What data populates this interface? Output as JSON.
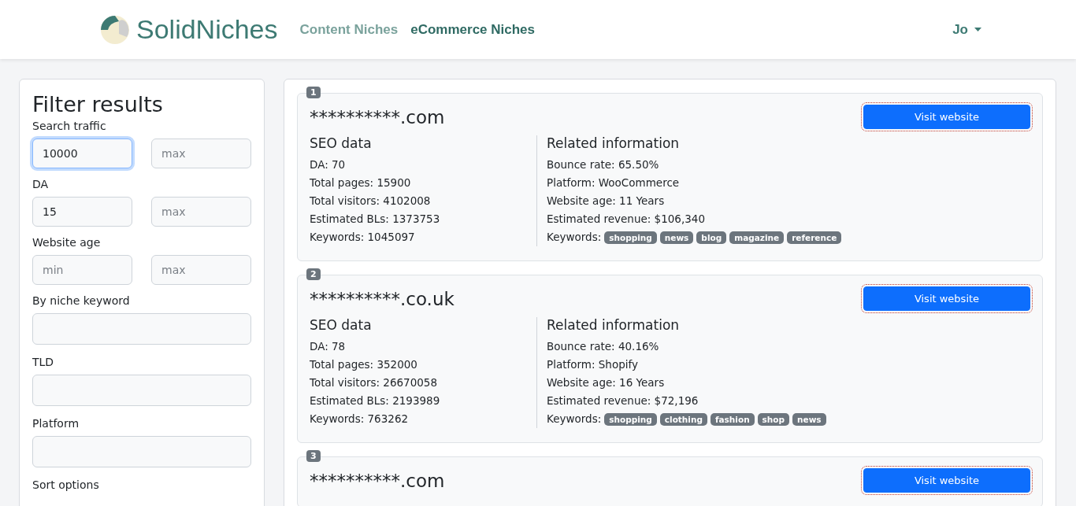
{
  "nav": {
    "logo": "SolidNiches",
    "links": [
      {
        "label": "Content Niches",
        "selected": false
      },
      {
        "label": "eCommerce Niches",
        "selected": true
      }
    ],
    "user": "Jo"
  },
  "filter": {
    "title": "Filter results",
    "groups": [
      {
        "label": "Search traffic",
        "kind": "range",
        "fields": [
          {
            "value": "10000",
            "focused": true
          },
          {
            "placeholder": "max",
            "focused": false
          }
        ]
      },
      {
        "label": "DA",
        "kind": "range",
        "fields": [
          {
            "value": "15",
            "focused": false
          },
          {
            "placeholder": "max",
            "focused": false
          }
        ]
      },
      {
        "label": "Website age",
        "kind": "range",
        "fields": [
          {
            "placeholder": "min",
            "focused": false
          },
          {
            "placeholder": "max",
            "focused": false
          }
        ]
      },
      {
        "label": "By niche keyword",
        "kind": "single",
        "fields": [
          {
            "focused": false
          }
        ]
      },
      {
        "label": "TLD",
        "kind": "single",
        "fields": [
          {
            "focused": false
          }
        ]
      },
      {
        "label": "Platform",
        "kind": "single",
        "fields": [
          {
            "focused": false
          }
        ]
      }
    ],
    "sort_label": "Sort options"
  },
  "results": [
    {
      "rank": "1",
      "domain": "**********.com",
      "button": "Visit website",
      "seo": {
        "title": "SEO data",
        "lines": [
          "DA: 70",
          "Total pages: 15900",
          "Total visitors: 4102008",
          "Estimated BLs: 1373753",
          "Keywords: 1045097"
        ]
      },
      "related": {
        "title": "Related information",
        "lines": [
          "Bounce rate: 65.50%",
          "Platform: WooCommerce",
          "Website age: 11 Years",
          "Estimated revenue: $106,340"
        ],
        "keywords_label": "Keywords:",
        "keywords": [
          "shopping",
          "news",
          "blog",
          "magazine",
          "reference"
        ]
      }
    },
    {
      "rank": "2",
      "domain": "**********.co.uk",
      "button": "Visit website",
      "seo": {
        "title": "SEO data",
        "lines": [
          "DA: 78",
          "Total pages: 352000",
          "Total visitors: 26670058",
          "Estimated BLs: 2193989",
          "Keywords: 763262"
        ]
      },
      "related": {
        "title": "Related information",
        "lines": [
          "Bounce rate: 40.16%",
          "Platform: Shopify",
          "Website age: 16 Years",
          "Estimated revenue: $72,196"
        ],
        "keywords_label": "Keywords:",
        "keywords": [
          "shopping",
          "clothing",
          "fashion",
          "shop",
          "news"
        ]
      }
    },
    {
      "rank": "3",
      "domain": "**********.com",
      "button": "Visit website"
    }
  ]
}
